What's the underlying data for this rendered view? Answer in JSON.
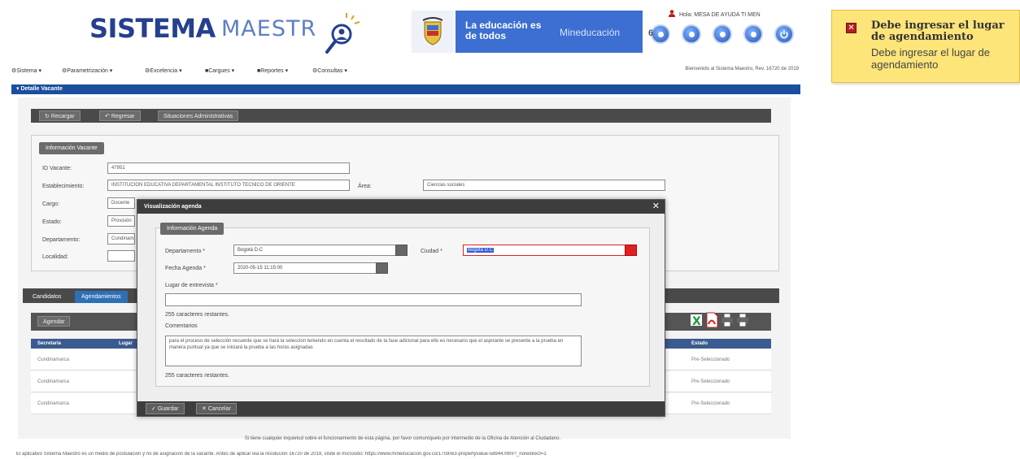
{
  "header": {
    "logo_sistema": "SISTEMA",
    "logo_maestro": "MAESTR",
    "gov_slogan": "La educación es de todos",
    "gov_ministry": "Mineducación",
    "user_line": "Hola: MESA DE AYUDA TI MEN",
    "icon_prefix": "6"
  },
  "menu": {
    "items": [
      "Sistema",
      "Parametrización",
      "Excelencia",
      "Cargues",
      "Reportes",
      "Consultas"
    ],
    "welcome": "Bienvenido al Sistema Maestro, Rev. 16720 de 2019"
  },
  "section_title": "Detalle Vacante",
  "toolbar": {
    "recargar": "Recargar",
    "regresar": "Regresar",
    "situaciones": "Situaciones Administrativas"
  },
  "info": {
    "legend": "Información Vacante",
    "id_label": "ID Vacante:",
    "id_value": "47951",
    "establecimiento_label": "Establecimiento:",
    "establecimiento_value": "INSTITUCION EDUCATIVA DEPARTAMENTAL INSTITUTO TECNICO DE ORIENTE",
    "area_label": "Área:",
    "area_value": "Ciencias sociales",
    "cargo_label": "Cargo:",
    "cargo_value": "Docente",
    "estado_label": "Estado:",
    "estado_value": "Provisión",
    "departamento_label": "Departamento:",
    "departamento_value": "Cundinamarca",
    "localidad_label": "Localidad:"
  },
  "tabs": {
    "candidatos": "Candidatos",
    "agendamientos": "Agendamientos"
  },
  "grid": {
    "agendar": "Agendar",
    "col_secretaria": "Secretaría",
    "col_lugar": "Lugar",
    "col_estado": "Estado",
    "rows": [
      {
        "secretaria": "Cundinamarca",
        "estado": "Pre-Seleccionado"
      },
      {
        "secretaria": "Cundinamarca",
        "estado": "Pre-Seleccionado"
      },
      {
        "secretaria": "Cundinamarca",
        "estado": "Pre-Seleccionado"
      }
    ]
  },
  "modal": {
    "title": "Visualización agenda",
    "legend": "Información Agenda",
    "departamento_label": "Departamento *",
    "departamento_value": "Bogotá D.C",
    "ciudad_label": "Ciudad *",
    "ciudad_value": "Bogotá D.C",
    "fecha_label": "Fecha Agenda *",
    "fecha_value": "2020-05-15 11:15:00",
    "lugar_label": "Lugar de entrevista *",
    "lugar_value": "",
    "lugar_counter": "255 caracteres restantes.",
    "comentarios_label": "Comentarios",
    "comentarios_value": "para el proceso de selección recuerde que se hará la selección teniendo en cuenta el resultado de la fase adicional para ello es necesario que el aspirante se presente a la prueba en manera puntual ya que se iniciará la prueba a las horas asignadas",
    "comentarios_counter": "255 caracteres restantes.",
    "guardar": "Guardar",
    "cancelar": "Cancelar"
  },
  "footer": {
    "line1": "Si tiene cualquier inquietud sobre el funcionamiento de esta página, por favor comuníquelo por intermedio de la Oficina de Atención al Ciudadano.",
    "line2": "El aplicativo Sistema Maestro es un medio de postulación y no de asignación de la vacante. Antes de aplicar lea la resolución 16720 de 2019, visite el micrositio: https://www.mineducacion.gov.co/1759/w3-propertyvalue-58944.html?_noredirect=1"
  },
  "notification": {
    "title": "Debe ingresar el lugar de agendamiento",
    "body": "Debe ingresar el lugar de agendamiento"
  },
  "colors": {
    "brand_blue": "#263f8f",
    "gov_blue": "#3c6fd1",
    "section_blue": "#1a4f9f",
    "error_red": "#d22222",
    "notification_yellow": "#fde57a"
  }
}
